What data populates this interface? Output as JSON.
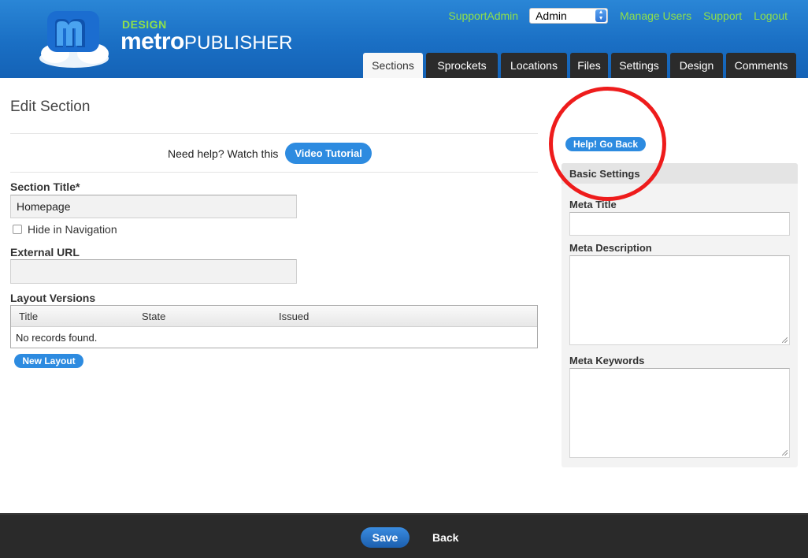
{
  "brand": {
    "small": "DESIGN",
    "main_bold": "metro",
    "main_light": "PUBLISHER",
    "logo_icon": "cloud-m-logo"
  },
  "topnav": {
    "user": "SupportAdmin",
    "role_selected": "Admin",
    "links": [
      "Manage Users",
      "Support",
      "Logout"
    ]
  },
  "tabs": [
    {
      "label": "Sections",
      "active": true
    },
    {
      "label": "Sprockets",
      "active": false
    },
    {
      "label": "Locations",
      "active": false
    },
    {
      "label": "Files",
      "active": false
    },
    {
      "label": "Settings",
      "active": false
    },
    {
      "label": "Design",
      "active": false
    },
    {
      "label": "Comments",
      "active": false
    }
  ],
  "page": {
    "title": "Edit Section",
    "help_text": "Need help? Watch this",
    "video_button": "Video Tutorial"
  },
  "form": {
    "section_title_label": "Section Title*",
    "section_title_value": "Homepage",
    "hide_nav_label": "Hide in Navigation",
    "hide_nav_checked": false,
    "external_url_label": "External URL",
    "external_url_value": ""
  },
  "layout_versions": {
    "label": "Layout Versions",
    "columns": [
      "Title",
      "State",
      "Issued"
    ],
    "empty_text": "No records found.",
    "new_button": "New Layout"
  },
  "sidebar": {
    "help_button": "Help! Go Back",
    "heading": "Basic Settings",
    "meta_title_label": "Meta Title",
    "meta_description_label": "Meta Description",
    "meta_keywords_label": "Meta Keywords"
  },
  "footer": {
    "save": "Save",
    "back": "Back"
  },
  "colors": {
    "header_blue": "#1a6fc4",
    "accent_green": "#8fe04a",
    "button_blue": "#2d8be0",
    "highlight_red": "#ee1c1c",
    "footer_dark": "#2a2a2a"
  }
}
